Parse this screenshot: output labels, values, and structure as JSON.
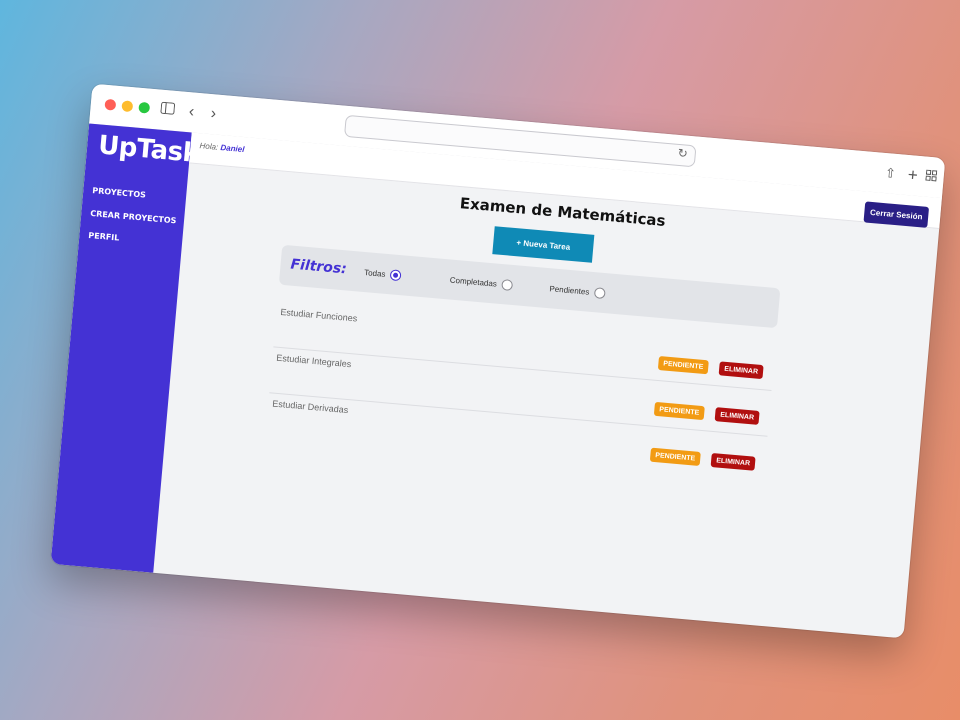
{
  "app": {
    "name": "UpTask"
  },
  "sidebar": {
    "items": [
      {
        "label": "PROYECTOS"
      },
      {
        "label": "CREAR PROYECTOS"
      },
      {
        "label": "PERFIL"
      }
    ]
  },
  "header": {
    "greeting": "Hola:",
    "user": "Daniel",
    "logout_label": "Cerrar Sesión"
  },
  "project": {
    "title": "Examen de Matemáticas",
    "new_task_label": "+ Nueva Tarea"
  },
  "filters": {
    "label": "Filtros:",
    "options": [
      {
        "label": "Todas",
        "selected": true
      },
      {
        "label": "Completadas",
        "selected": false
      },
      {
        "label": "Pendientes",
        "selected": false
      }
    ]
  },
  "tasks": [
    {
      "name": "Estudiar Funciones",
      "status": "PENDIENTE",
      "delete_label": "ELIMINAR"
    },
    {
      "name": "Estudiar Integrales",
      "status": "PENDIENTE",
      "delete_label": "ELIMINAR"
    },
    {
      "name": "Estudiar Derivadas",
      "status": "PENDIENTE",
      "delete_label": "ELIMINAR"
    }
  ],
  "colors": {
    "brand": "#4432d4",
    "logout": "#2a1f86",
    "new_task": "#0f8ab6",
    "pending": "#f29b14",
    "delete": "#b10f0f"
  },
  "icons": [
    "sidebar-toggle-icon",
    "back-icon",
    "forward-icon",
    "reload-icon",
    "share-icon",
    "new-tab-icon",
    "tab-overview-icon"
  ]
}
